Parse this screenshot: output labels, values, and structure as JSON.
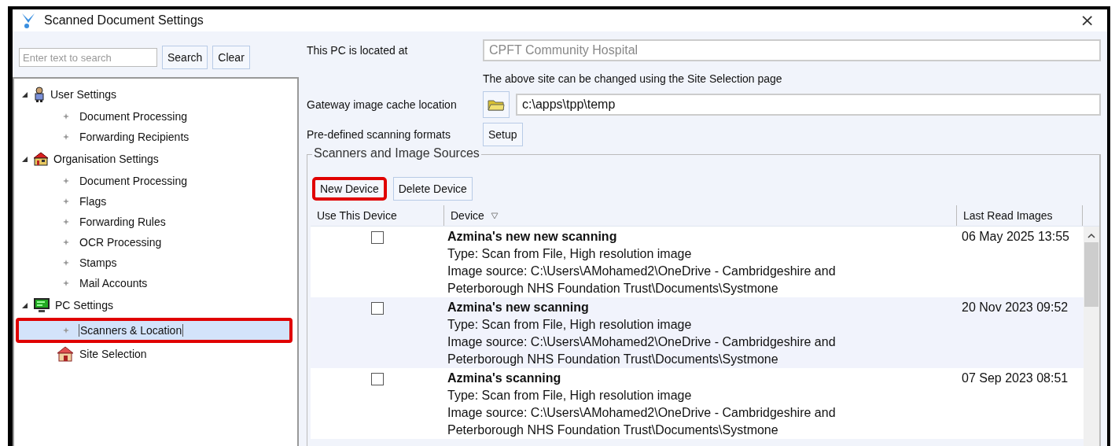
{
  "window": {
    "title": "Scanned Document Settings",
    "close": "×"
  },
  "search": {
    "placeholder": "Enter text to search",
    "buttons": [
      "Search",
      "Clear"
    ]
  },
  "tree": [
    {
      "label": "User Settings",
      "kind": "user",
      "expanded": true,
      "children": [
        {
          "label": "Document Processing",
          "kind": "setting",
          "selected": false,
          "highlighted": false
        },
        {
          "label": "Forwarding Recipients",
          "kind": "setting",
          "selected": false,
          "highlighted": false
        }
      ]
    },
    {
      "label": "Organisation Settings",
      "kind": "organisation",
      "expanded": true,
      "children": [
        {
          "label": "Document Processing",
          "kind": "setting",
          "selected": false,
          "highlighted": false
        },
        {
          "label": "Flags",
          "kind": "setting",
          "selected": false,
          "highlighted": false
        },
        {
          "label": "Forwarding Rules",
          "kind": "setting",
          "selected": false,
          "highlighted": false
        },
        {
          "label": "OCR Processing",
          "kind": "setting",
          "selected": false,
          "highlighted": false
        },
        {
          "label": "Stamps",
          "kind": "setting",
          "selected": false,
          "highlighted": false
        },
        {
          "label": "Mail Accounts",
          "kind": "setting",
          "selected": false,
          "highlighted": false
        }
      ]
    },
    {
      "label": "PC Settings",
      "kind": "pc",
      "expanded": true,
      "children": [
        {
          "label": "Scanners & Location",
          "kind": "setting",
          "selected": true,
          "highlighted": true
        },
        {
          "label": "Site Selection",
          "kind": "site",
          "selected": false,
          "highlighted": false
        }
      ]
    }
  ],
  "location": {
    "label": "This PC is located at",
    "value": "CPFT Community Hospital",
    "note": "The above site can be changed using the Site Selection page"
  },
  "cache": {
    "label": "Gateway image cache location",
    "value": "c:\\apps\\tpp\\temp"
  },
  "formats": {
    "label": "Pre-defined scanning formats",
    "button": "Setup"
  },
  "sources": {
    "title": "Scanners and Image Sources",
    "buttons": [
      {
        "label": "New Device",
        "highlighted": true
      },
      {
        "label": "Delete Device",
        "highlighted": false
      }
    ],
    "columns": [
      "Use This Device",
      "Device",
      "Last Read Images"
    ],
    "rows": [
      {
        "checked": false,
        "name": "Azmina's new new scanning",
        "type": "Type: Scan from File, High resolution image",
        "source": "Image source: C:\\Users\\AMohamed2\\OneDrive - Cambridgeshire and Peterborough NHS Foundation Trust\\Documents\\Systmone",
        "last_read": "06 May 2025 13:55"
      },
      {
        "checked": false,
        "name": "Azmina's new scanning",
        "type": "Type: Scan from File, High resolution image",
        "source": "Image source: C:\\Users\\AMohamed2\\OneDrive - Cambridgeshire and Peterborough NHS Foundation Trust\\Documents\\Systmone",
        "last_read": "20 Nov 2023 09:52"
      },
      {
        "checked": false,
        "name": "Azmina's scanning",
        "type": "Type: Scan from File, High resolution image",
        "source": "Image source: C:\\Users\\AMohamed2\\OneDrive - Cambridgeshire and Peterborough NHS Foundation Trust\\Documents\\Systmone",
        "last_read": "07 Sep 2023 08:51"
      }
    ]
  }
}
